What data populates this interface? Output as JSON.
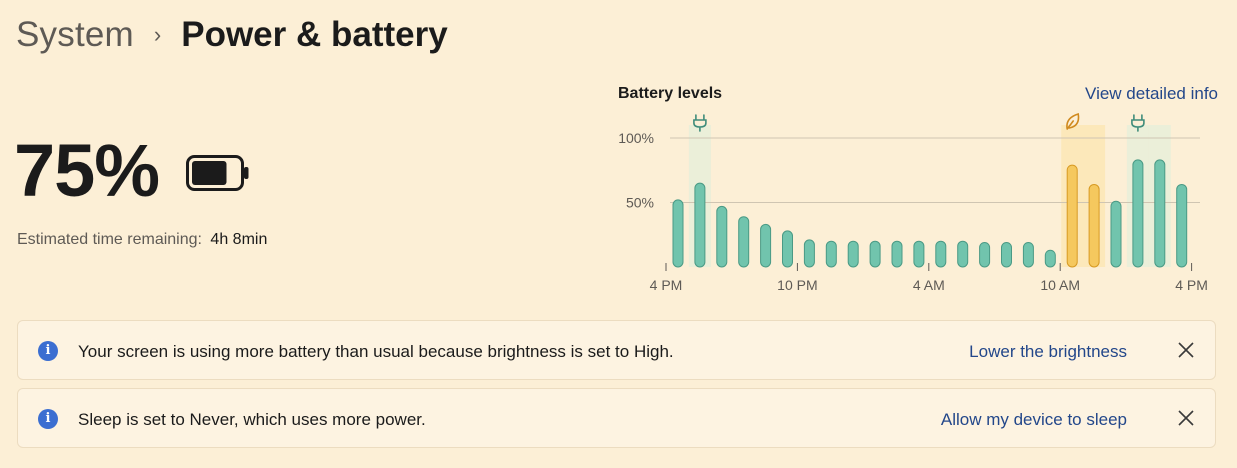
{
  "breadcrumb": {
    "parent": "System",
    "separator": "›",
    "current": "Power & battery"
  },
  "battery": {
    "percent_label": "75%",
    "level_fraction": 0.75,
    "estimate_label": "Estimated time remaining:",
    "estimate_value": "4h 8min"
  },
  "chart_header": {
    "title": "Battery levels",
    "detail_link": "View detailed info"
  },
  "colors": {
    "normal": "#71c4ad",
    "saver": "#f5c85e",
    "accent_link": "#23478a",
    "info": "#3b6ed1"
  },
  "chart_data": {
    "type": "bar",
    "title": "Battery levels",
    "x_tick_labels": [
      "4 PM",
      "10 PM",
      "4 AM",
      "10 AM",
      "4 PM"
    ],
    "y_tick_labels": [
      "50%",
      "100%"
    ],
    "ylim": [
      0,
      100
    ],
    "grid": true,
    "values": [
      52,
      65,
      47,
      39,
      33,
      28,
      21,
      20,
      20,
      20,
      20,
      20,
      20,
      20,
      19,
      19,
      19,
      13,
      79,
      64,
      51,
      83,
      83,
      64
    ],
    "modes": [
      "normal",
      "normal",
      "normal",
      "normal",
      "normal",
      "normal",
      "normal",
      "normal",
      "normal",
      "normal",
      "normal",
      "normal",
      "normal",
      "normal",
      "normal",
      "normal",
      "normal",
      "normal",
      "saver",
      "saver",
      "normal",
      "normal",
      "normal",
      "normal"
    ],
    "plug_icons_at_bar": [
      1,
      21
    ],
    "saver_icon_at_bar": 18,
    "highlight_bars": [
      1,
      18,
      19,
      21,
      22
    ]
  },
  "notifications": [
    {
      "text": "Your screen is using more battery than usual because brightness is set to High.",
      "action": "Lower the brightness"
    },
    {
      "text": "Sleep is set to Never, which uses more power.",
      "action": "Allow my device to sleep"
    }
  ]
}
